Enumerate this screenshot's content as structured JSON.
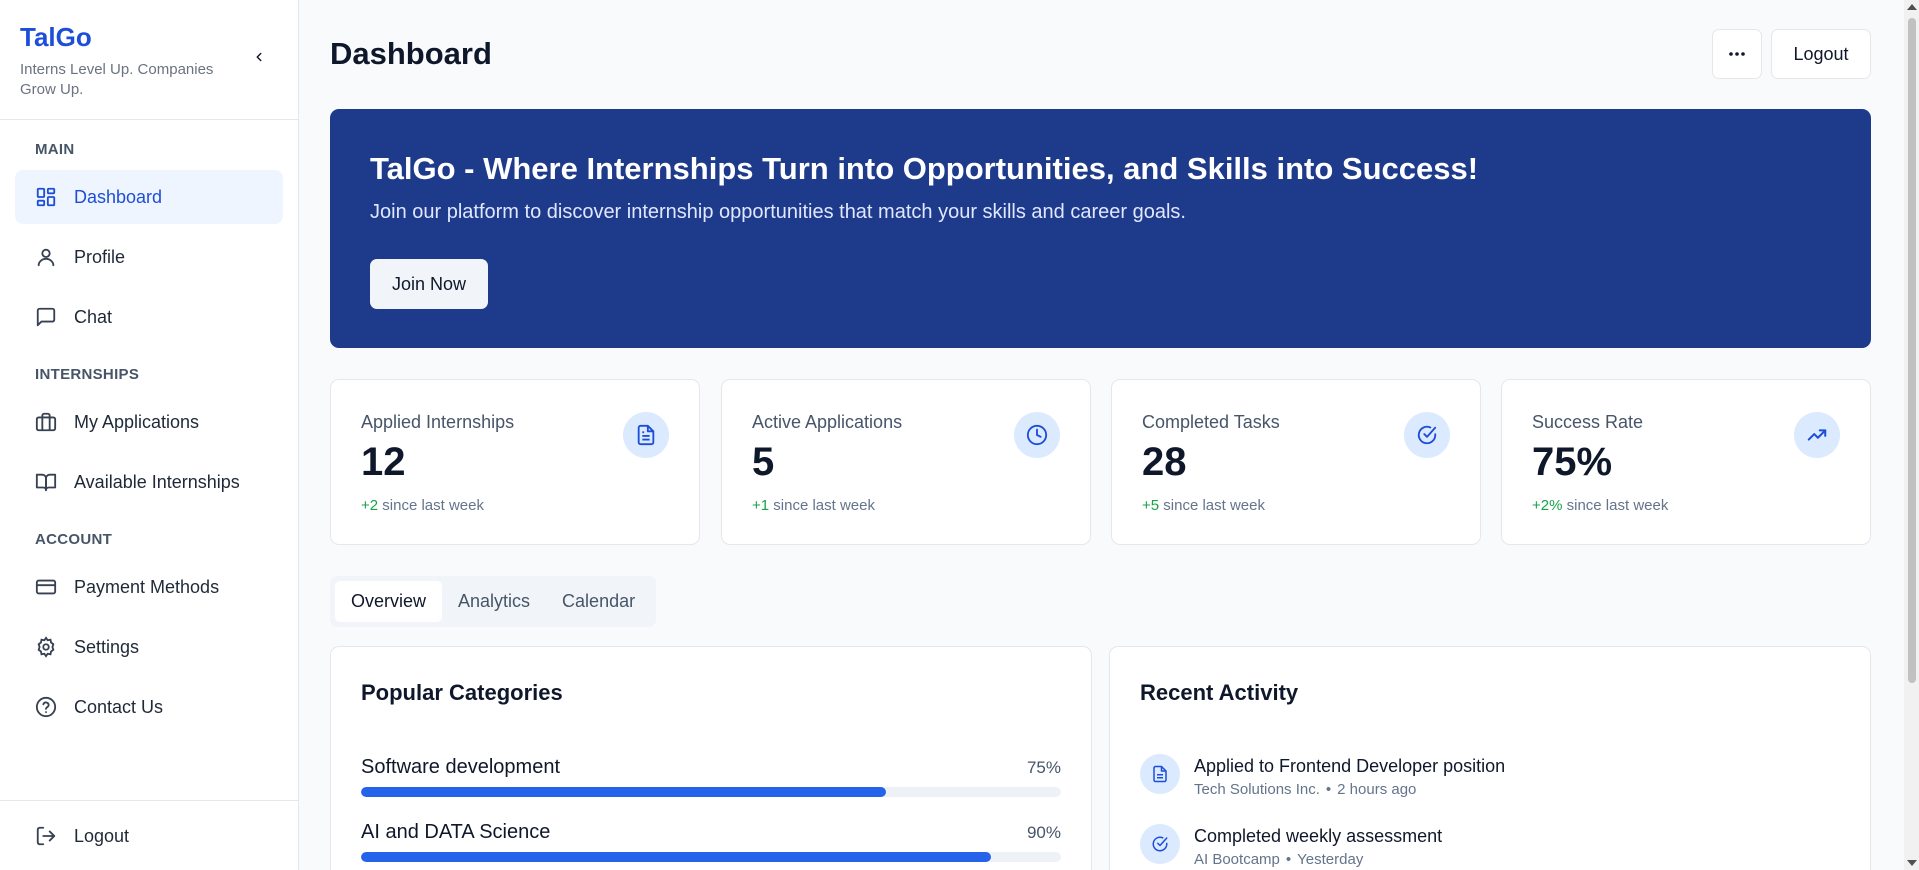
{
  "sidebar": {
    "brand": "TalGo",
    "tagline": "Interns Level Up. Companies Grow Up.",
    "sections": {
      "main": "MAIN",
      "internships": "INTERNSHIPS",
      "account": "ACCOUNT"
    },
    "items": {
      "dashboard": "Dashboard",
      "profile": "Profile",
      "chat": "Chat",
      "my_applications": "My Applications",
      "available_internships": "Available Internships",
      "payment_methods": "Payment Methods",
      "settings": "Settings",
      "contact_us": "Contact Us"
    },
    "logout": "Logout"
  },
  "header": {
    "title": "Dashboard",
    "logout": "Logout"
  },
  "hero": {
    "title": "TalGo - Where Internships Turn into Opportunities, and Skills into Success!",
    "subtitle": "Join our platform to discover internship opportunities that match your skills and career goals.",
    "button": "Join Now"
  },
  "stats": [
    {
      "title": "Applied Internships",
      "value": "12",
      "change": "+2",
      "suffix": " since last week",
      "icon": "document-icon"
    },
    {
      "title": "Active Applications",
      "value": "5",
      "change": "+1",
      "suffix": " since last week",
      "icon": "clock-icon"
    },
    {
      "title": "Completed Tasks",
      "value": "28",
      "change": "+5",
      "suffix": " since last week",
      "icon": "check-circle-icon"
    },
    {
      "title": "Success Rate",
      "value": "75%",
      "change": "+2%",
      "suffix": " since last week",
      "icon": "trending-up-icon"
    }
  ],
  "tabs": {
    "overview": "Overview",
    "analytics": "Analytics",
    "calendar": "Calendar"
  },
  "categories": {
    "title": "Popular Categories",
    "items": [
      {
        "name": "Software development",
        "pct_label": "75%",
        "pct": 75
      },
      {
        "name": "AI and DATA Science",
        "pct_label": "90%",
        "pct": 90
      }
    ]
  },
  "activity": {
    "title": "Recent Activity",
    "items": [
      {
        "title": "Applied to Frontend Developer position",
        "org": "Tech Solutions Inc.",
        "time": "2 hours ago",
        "icon": "document-icon"
      },
      {
        "title": "Completed weekly assessment",
        "org": "AI Bootcamp",
        "time": "Yesterday",
        "icon": "check-circle-icon"
      }
    ]
  },
  "colors": {
    "accent": "#1d4ed8",
    "hero_bg": "#1e3a8a",
    "positive": "#16a34a",
    "bar": "#2563eb"
  }
}
